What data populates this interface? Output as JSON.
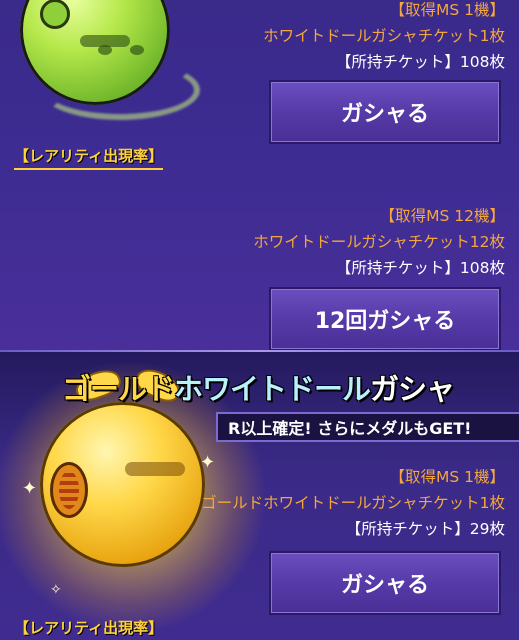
{
  "section1": {
    "acquire_label": "【取得MS 1機】",
    "ticket_name": "ホワイトドールガシャチケット1枚",
    "owned_label": "【所持チケット】108枚",
    "button_label": "ガシャる",
    "rarity_label": "【レアリティ出現率】"
  },
  "section2": {
    "acquire_label": "【取得MS 12機】",
    "ticket_name": "ホワイトドールガシャチケット12枚",
    "owned_label": "【所持チケット】108枚",
    "button_label": "12回ガシャる"
  },
  "section3": {
    "title_part1": "ゴールド",
    "title_part2": "ホワイトドール",
    "title_part3": "ガシャ",
    "subtitle": "R以上確定! さらにメダルもGET!",
    "acquire_label": "【取得MS 1機】",
    "ticket_name": "ゴールドホワイトドールガシャチケット1枚",
    "owned_label": "【所持チケット】29枚",
    "button_label": "ガシャる",
    "rarity_label": "【レアリティ出現率】"
  },
  "icons": {
    "green_haro": "green-haro-illustration",
    "gold_haro": "gold-haro-illustration",
    "sparkle": "sparkle-icon"
  },
  "colors": {
    "orange_text": "#f3a73c",
    "rarity_gold": "#ffd23c",
    "button_purple": "#563aa8",
    "background_purple": "#3d2c92"
  }
}
